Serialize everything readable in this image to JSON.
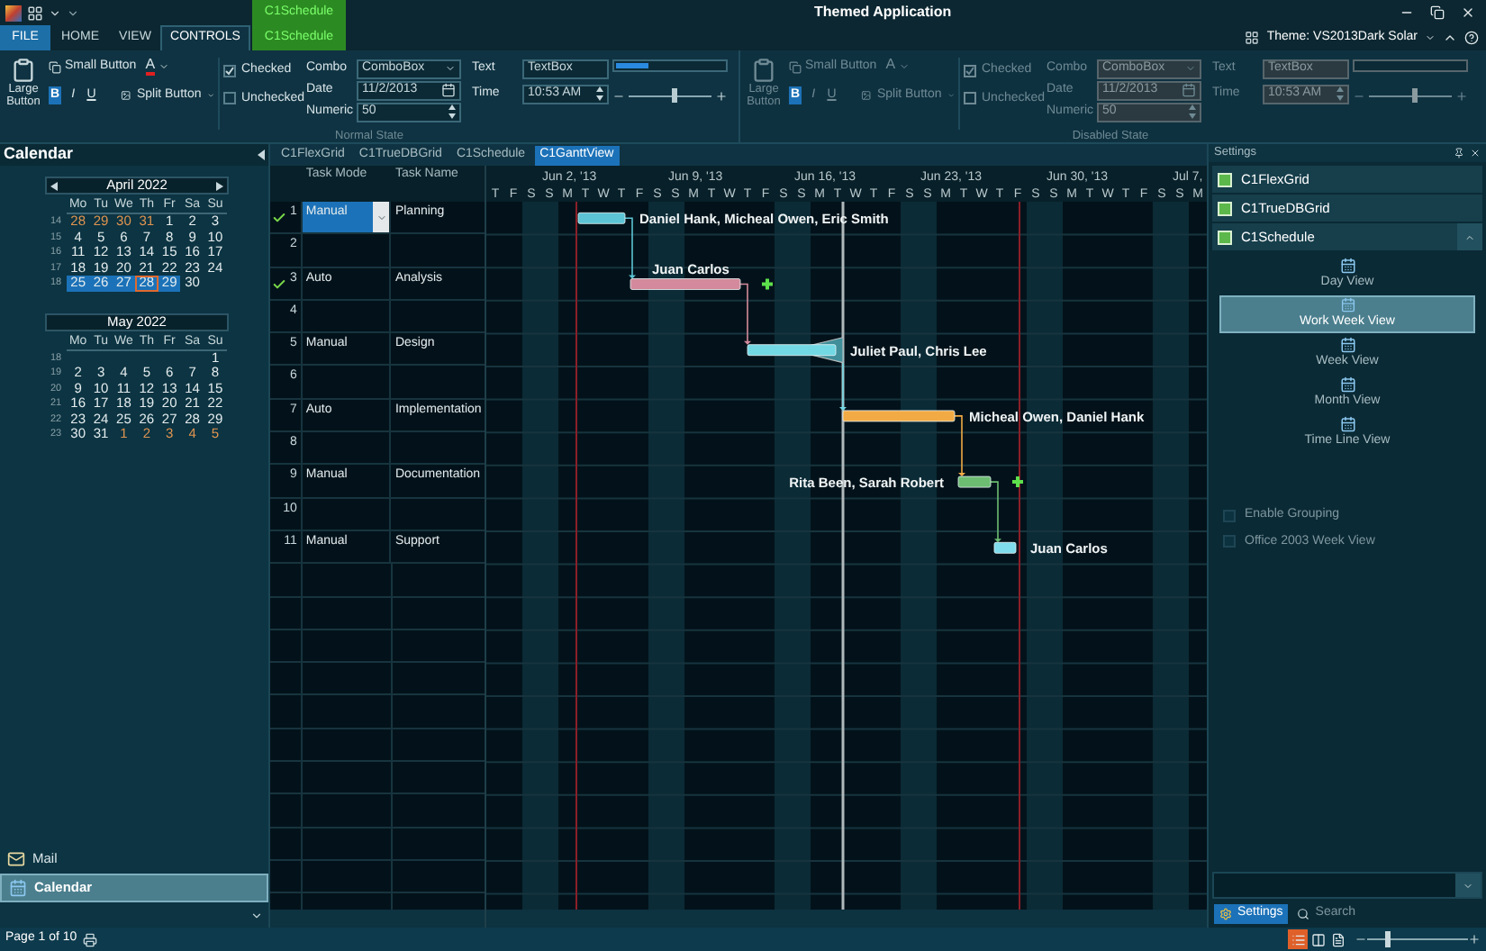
{
  "title_bar": {
    "context_label": "C1Schedule",
    "title": "Themed Application"
  },
  "ribbon_tabs": [
    {
      "label": "FILE",
      "kind": "file",
      "selected": false
    },
    {
      "label": "HOME",
      "kind": "tab",
      "selected": false
    },
    {
      "label": "VIEW",
      "kind": "tab",
      "selected": false
    },
    {
      "label": "CONTROLS",
      "kind": "tab",
      "selected": true
    },
    {
      "label": "C1Schedule",
      "kind": "context",
      "selected": false
    }
  ],
  "theme_selector": {
    "label": "Theme: VS2013Dark Solar"
  },
  "ribbon_groups": [
    {
      "title": "Normal State",
      "disabled": false,
      "large_button": "Large Button",
      "small_button": "Small Button",
      "font_color": "A",
      "split_button": "Split Button",
      "format_buttons": [
        {
          "label": "B",
          "kind": "bold",
          "on": true
        },
        {
          "label": "I",
          "kind": "italic",
          "on": false
        },
        {
          "label": "U",
          "kind": "underline",
          "on": false
        }
      ],
      "checkboxes": [
        {
          "label": "Checked",
          "checked": true
        },
        {
          "label": "Unchecked",
          "checked": false
        }
      ],
      "fields": [
        {
          "label": "Combo",
          "value": "ComboBox",
          "kind": "combo"
        },
        {
          "label": "Date",
          "value": "11/2/2013",
          "kind": "date"
        },
        {
          "label": "Numeric",
          "value": "50",
          "kind": "spin"
        }
      ],
      "text_fields": [
        {
          "label": "Text",
          "value": "TextBox",
          "kind": "text"
        },
        {
          "label": "Time",
          "value": "10:53 AM",
          "kind": "spin"
        }
      ],
      "progress": {
        "level": 0.3
      },
      "slider": {
        "level": 0.55
      }
    },
    {
      "title": "Disabled State",
      "disabled": true,
      "large_button": "Large Button",
      "small_button": "Small Button",
      "font_color": "A",
      "split_button": "Split Button",
      "format_buttons": [
        {
          "label": "B",
          "kind": "bold",
          "on": true
        },
        {
          "label": "I",
          "kind": "italic",
          "on": false
        },
        {
          "label": "U",
          "kind": "underline",
          "on": false
        }
      ],
      "checkboxes": [
        {
          "label": "Checked",
          "checked": true
        },
        {
          "label": "Unchecked",
          "checked": false
        }
      ],
      "fields": [
        {
          "label": "Combo",
          "value": "ComboBox",
          "kind": "combo"
        },
        {
          "label": "Date",
          "value": "11/2/2013",
          "kind": "date"
        },
        {
          "label": "Numeric",
          "value": "50",
          "kind": "spin"
        }
      ],
      "text_fields": [
        {
          "label": "Text",
          "value": "TextBox",
          "kind": "text"
        },
        {
          "label": "Time",
          "value": "10:53 AM",
          "kind": "spin"
        }
      ],
      "progress": {
        "level": 0
      },
      "slider": {
        "level": 0.55
      }
    }
  ],
  "calendar_panel": {
    "title": "Calendar",
    "months": [
      {
        "title": "April 2022",
        "arrows": true,
        "weekdays": [
          "Mo",
          "Tu",
          "We",
          "Th",
          "Fr",
          "Sa",
          "Su"
        ],
        "weeks": [
          {
            "number": "14",
            "days": [
              {
                "d": "28",
                "other_month": true,
                "today": false,
                "selected": false
              },
              {
                "d": "29",
                "other_month": true,
                "today": false,
                "selected": false
              },
              {
                "d": "30",
                "other_month": true,
                "today": false,
                "selected": false
              },
              {
                "d": "31",
                "other_month": true,
                "today": false,
                "selected": false
              },
              {
                "d": "1",
                "other_month": false,
                "today": false,
                "selected": false
              },
              {
                "d": "2",
                "other_month": false,
                "today": false,
                "selected": false
              },
              {
                "d": "3",
                "other_month": false,
                "today": false,
                "selected": false
              }
            ]
          },
          {
            "number": "15",
            "days": [
              {
                "d": "4",
                "other_month": false,
                "today": false,
                "selected": false
              },
              {
                "d": "5",
                "other_month": false,
                "today": false,
                "selected": false
              },
              {
                "d": "6",
                "other_month": false,
                "today": false,
                "selected": false
              },
              {
                "d": "7",
                "other_month": false,
                "today": false,
                "selected": false
              },
              {
                "d": "8",
                "other_month": false,
                "today": false,
                "selected": false
              },
              {
                "d": "9",
                "other_month": false,
                "today": false,
                "selected": false
              },
              {
                "d": "10",
                "other_month": false,
                "today": false,
                "selected": false
              }
            ]
          },
          {
            "number": "16",
            "days": [
              {
                "d": "11",
                "other_month": false,
                "today": false,
                "selected": false
              },
              {
                "d": "12",
                "other_month": false,
                "today": false,
                "selected": false
              },
              {
                "d": "13",
                "other_month": false,
                "today": false,
                "selected": false
              },
              {
                "d": "14",
                "other_month": false,
                "today": false,
                "selected": false
              },
              {
                "d": "15",
                "other_month": false,
                "today": false,
                "selected": false
              },
              {
                "d": "16",
                "other_month": false,
                "today": false,
                "selected": false
              },
              {
                "d": "17",
                "other_month": false,
                "today": false,
                "selected": false
              }
            ]
          },
          {
            "number": "17",
            "days": [
              {
                "d": "18",
                "other_month": false,
                "today": false,
                "selected": false
              },
              {
                "d": "19",
                "other_month": false,
                "today": false,
                "selected": false
              },
              {
                "d": "20",
                "other_month": false,
                "today": false,
                "selected": false
              },
              {
                "d": "21",
                "other_month": false,
                "today": false,
                "selected": false
              },
              {
                "d": "22",
                "other_month": false,
                "today": false,
                "selected": false
              },
              {
                "d": "23",
                "other_month": false,
                "today": false,
                "selected": false
              },
              {
                "d": "24",
                "other_month": false,
                "today": false,
                "selected": false
              }
            ]
          },
          {
            "number": "18",
            "days": [
              {
                "d": "25",
                "other_month": false,
                "today": false,
                "selected": true
              },
              {
                "d": "26",
                "other_month": false,
                "today": false,
                "selected": true
              },
              {
                "d": "27",
                "other_month": false,
                "today": false,
                "selected": true
              },
              {
                "d": "28",
                "other_month": false,
                "today": true,
                "selected": true
              },
              {
                "d": "29",
                "other_month": false,
                "today": false,
                "selected": true
              },
              {
                "d": "30",
                "other_month": false,
                "today": false,
                "selected": false
              }
            ]
          }
        ]
      },
      {
        "title": "May 2022",
        "arrows": false,
        "weekdays": [
          "Mo",
          "Tu",
          "We",
          "Th",
          "Fr",
          "Sa",
          "Su"
        ],
        "weeks": [
          {
            "number": "18",
            "kind": "end_aligned",
            "days": [
              {
                "d": "1",
                "other_month": false,
                "today": false,
                "selected": false
              }
            ]
          },
          {
            "number": "19",
            "days": [
              {
                "d": "2",
                "other_month": false,
                "today": false,
                "selected": false
              },
              {
                "d": "3",
                "other_month": false,
                "today": false,
                "selected": false
              },
              {
                "d": "4",
                "other_month": false,
                "today": false,
                "selected": false
              },
              {
                "d": "5",
                "other_month": false,
                "today": false,
                "selected": false
              },
              {
                "d": "6",
                "other_month": false,
                "today": false,
                "selected": false
              },
              {
                "d": "7",
                "other_month": false,
                "today": false,
                "selected": false
              },
              {
                "d": "8",
                "other_month": false,
                "today": false,
                "selected": false
              }
            ]
          },
          {
            "number": "20",
            "days": [
              {
                "d": "9",
                "other_month": false,
                "today": false,
                "selected": false
              },
              {
                "d": "10",
                "other_month": false,
                "today": false,
                "selected": false
              },
              {
                "d": "11",
                "other_month": false,
                "today": false,
                "selected": false
              },
              {
                "d": "12",
                "other_month": false,
                "today": false,
                "selected": false
              },
              {
                "d": "13",
                "other_month": false,
                "today": false,
                "selected": false
              },
              {
                "d": "14",
                "other_month": false,
                "today": false,
                "selected": false
              },
              {
                "d": "15",
                "other_month": false,
                "today": false,
                "selected": false
              }
            ]
          },
          {
            "number": "21",
            "days": [
              {
                "d": "16",
                "other_month": false,
                "today": false,
                "selected": false
              },
              {
                "d": "17",
                "other_month": false,
                "today": false,
                "selected": false
              },
              {
                "d": "18",
                "other_month": false,
                "today": false,
                "selected": false
              },
              {
                "d": "19",
                "other_month": false,
                "today": false,
                "selected": false
              },
              {
                "d": "20",
                "other_month": false,
                "today": false,
                "selected": false
              },
              {
                "d": "21",
                "other_month": false,
                "today": false,
                "selected": false
              },
              {
                "d": "22",
                "other_month": false,
                "today": false,
                "selected": false
              }
            ]
          },
          {
            "number": "22",
            "days": [
              {
                "d": "23",
                "other_month": false,
                "today": false,
                "selected": false
              },
              {
                "d": "24",
                "other_month": false,
                "today": false,
                "selected": false
              },
              {
                "d": "25",
                "other_month": false,
                "today": false,
                "selected": false
              },
              {
                "d": "26",
                "other_month": false,
                "today": false,
                "selected": false
              },
              {
                "d": "27",
                "other_month": false,
                "today": false,
                "selected": false
              },
              {
                "d": "28",
                "other_month": false,
                "today": false,
                "selected": false
              },
              {
                "d": "29",
                "other_month": false,
                "today": false,
                "selected": false
              }
            ]
          },
          {
            "number": "23",
            "days": [
              {
                "d": "30",
                "other_month": false,
                "today": false,
                "selected": false
              },
              {
                "d": "31",
                "other_month": false,
                "today": false,
                "selected": false
              },
              {
                "d": "1",
                "other_month": true,
                "today": false,
                "selected": false
              },
              {
                "d": "2",
                "other_month": true,
                "today": false,
                "selected": false
              },
              {
                "d": "3",
                "other_month": true,
                "today": false,
                "selected": false
              },
              {
                "d": "4",
                "other_month": true,
                "today": false,
                "selected": false
              },
              {
                "d": "5",
                "other_month": true,
                "today": false,
                "selected": false
              }
            ]
          }
        ]
      }
    ],
    "nav": [
      {
        "label": "Mail",
        "selected": false
      },
      {
        "label": "Calendar",
        "selected": true
      }
    ]
  },
  "document_tabs": [
    {
      "label": "C1FlexGrid",
      "selected": false
    },
    {
      "label": "C1TrueDBGrid",
      "selected": false
    },
    {
      "label": "C1Schedule",
      "selected": false
    },
    {
      "label": "C1GanttView",
      "selected": true
    }
  ],
  "gantt": {
    "columns": [
      "Task Mode",
      "Task Name"
    ],
    "weeks": [
      "Jun 2, '13",
      "Jun 9, '13",
      "Jun 16, '13",
      "Jun 23, '13",
      "Jun 30, '13",
      "Jul 7,"
    ],
    "days": [
      "T",
      "F",
      "S",
      "S",
      "M",
      "T",
      "W",
      "T",
      "F",
      "S",
      "S",
      "M",
      "T",
      "W",
      "T",
      "F",
      "S",
      "S",
      "M",
      "T",
      "W",
      "T",
      "F",
      "S",
      "S",
      "M",
      "T",
      "W",
      "T",
      "F",
      "S",
      "S",
      "M",
      "T",
      "W",
      "T",
      "F",
      "S",
      "S",
      "M"
    ],
    "tasks": [
      {
        "number": "1",
        "kind": "task",
        "mode": "Manual",
        "name": "Planning",
        "done": true,
        "editing": true,
        "resources": "Daniel Hank, Micheal Owen, Eric Smith",
        "color": "#5cc4d4"
      },
      {
        "number": "2",
        "kind": "empty",
        "done": false,
        "editing": false
      },
      {
        "number": "3",
        "kind": "task",
        "mode": "Auto",
        "name": "Analysis",
        "done": true,
        "editing": false,
        "resources": "Juan Carlos",
        "color": "#d48a9c"
      },
      {
        "number": "4",
        "kind": "empty",
        "done": false,
        "editing": false
      },
      {
        "number": "5",
        "kind": "task",
        "mode": "Manual",
        "name": "Design",
        "done": false,
        "editing": false,
        "resources": "Juliet Paul, Chris Lee",
        "color": "#72d8e4"
      },
      {
        "number": "6",
        "kind": "empty",
        "done": false,
        "editing": false
      },
      {
        "number": "7",
        "kind": "task",
        "mode": "Auto",
        "name": "Implementation",
        "done": false,
        "editing": false,
        "resources": "Micheal Owen, Daniel Hank",
        "color": "#f2aa44"
      },
      {
        "number": "8",
        "kind": "empty",
        "done": false,
        "editing": false
      },
      {
        "number": "9",
        "kind": "task",
        "mode": "Manual",
        "name": "Documentation",
        "done": false,
        "editing": false,
        "resources": "Rita Been, Sarah Robert",
        "color": "#6cbc72"
      },
      {
        "number": "10",
        "kind": "empty",
        "done": false,
        "editing": false
      },
      {
        "number": "11",
        "kind": "task",
        "mode": "Manual",
        "name": "Support",
        "done": false,
        "editing": false,
        "resources": "Juan Carlos",
        "color": "#7edcec"
      }
    ]
  },
  "settings_panel": {
    "title": "Settings",
    "groups": [
      {
        "label": "C1FlexGrid",
        "expanded": false
      },
      {
        "label": "C1TrueDBGrid",
        "expanded": false
      },
      {
        "label": "C1Schedule",
        "expanded": true
      }
    ],
    "views": [
      {
        "label": "Day View",
        "selected": false
      },
      {
        "label": "Work Week View",
        "selected": true
      },
      {
        "label": "Week View",
        "selected": false
      },
      {
        "label": "Month View",
        "selected": false
      },
      {
        "label": "Time Line View",
        "selected": false
      }
    ],
    "options": [
      {
        "label": "Enable Grouping",
        "checked": false
      },
      {
        "label": "Office 2003 Week View",
        "checked": false
      }
    ],
    "tabs": [
      {
        "label": "Settings",
        "selected": true
      },
      {
        "label": "Search",
        "selected": false
      }
    ]
  },
  "status_bar": {
    "page": "Page 1 of 10",
    "views": [
      {
        "selected": true
      },
      {
        "selected": false
      },
      {
        "selected": false
      }
    ],
    "zoom": {
      "level": 0.2
    }
  }
}
